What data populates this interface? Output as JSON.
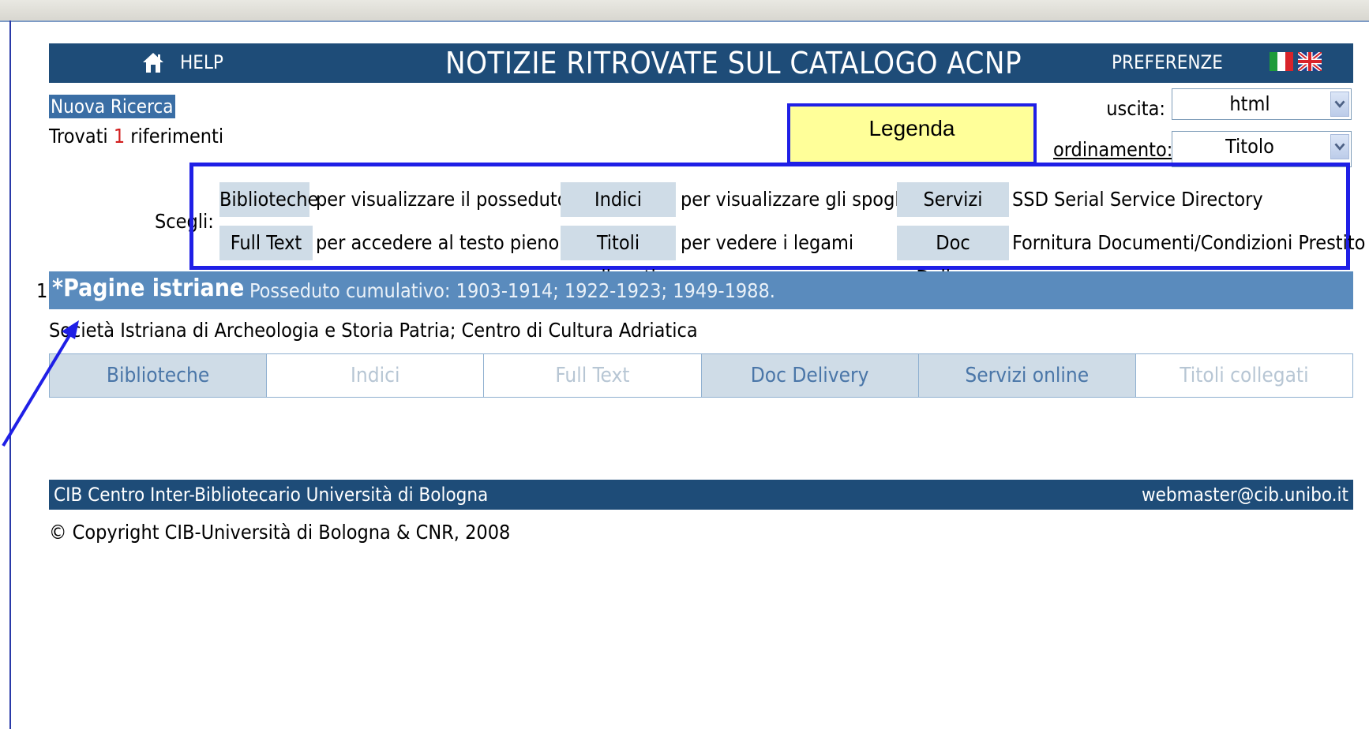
{
  "header": {
    "help_label": "HELP",
    "title": "NOTIZIE RITROVATE SUL CATALOGO ACNP",
    "preferences_label": "PREFERENZE",
    "colors": {
      "bar": "#1e4c78"
    }
  },
  "search": {
    "new_search_label": "Nuova Ricerca",
    "found_prefix": "Trovati",
    "found_count": "1",
    "found_suffix": "riferimenti"
  },
  "legend": {
    "label": "Legenda"
  },
  "options": {
    "output_label": "uscita:",
    "output_value": "html",
    "order_label": "ordinamento:",
    "order_value": "Titolo"
  },
  "choose": {
    "label": "Scegli:",
    "items": [
      {
        "tag": "Biblioteche",
        "desc": "per visualizzare il posseduto"
      },
      {
        "tag": "Indici",
        "desc": "per visualizzare gli spogli"
      },
      {
        "tag": "Servizi online",
        "desc": "SSD Serial Service Directory"
      },
      {
        "tag": "Full Text",
        "desc": "per accedere al testo pieno"
      },
      {
        "tag": "Titoli collegati",
        "desc": "per vedere i legami"
      },
      {
        "tag": "Doc Delivery",
        "desc": "Fornitura Documenti/Condizioni Prestito"
      }
    ]
  },
  "result": {
    "number": "1",
    "title": "*Pagine istriane",
    "holdings": "Posseduto cumulativo: 1903-1914; 1922-1923; 1949-1988.",
    "publisher": "Società Istriana di Archeologia e Storia Patria; Centro di Cultura Adriatica",
    "actions": [
      {
        "label": "Biblioteche",
        "enabled": true
      },
      {
        "label": "Indici",
        "enabled": false
      },
      {
        "label": "Full Text",
        "enabled": false
      },
      {
        "label": "Doc Delivery",
        "enabled": true
      },
      {
        "label": "Servizi online",
        "enabled": true
      },
      {
        "label": "Titoli collegati",
        "enabled": false
      }
    ]
  },
  "footer": {
    "org": "CIB Centro Inter-Bibliotecario Università di Bologna",
    "email": "webmaster@cib.unibo.it",
    "copyright": "© Copyright CIB-Università di Bologna & CNR, 2008"
  },
  "icons": [
    "home-icon",
    "italian-flag-icon",
    "uk-flag-icon",
    "dropdown-arrow-icon"
  ]
}
